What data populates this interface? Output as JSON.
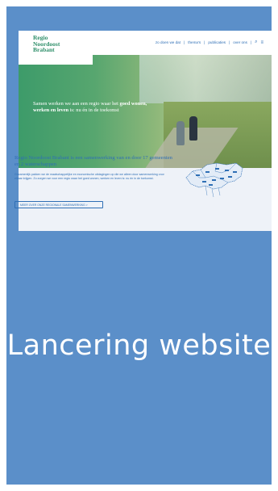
{
  "site": {
    "logo_lines": [
      "Regio",
      "Noordoost",
      "Brabant"
    ],
    "nav": [
      "zo doen we dat",
      "thema's",
      "publicaties",
      "over ons"
    ],
    "hero_text_pre": "Samen werken we aan een regio waar het ",
    "hero_text_bold": "goed wonen, werken en leven",
    "hero_text_post": " is: nu én in de toekomst",
    "intro_heading": "Regio Noordoost Brabant is een samenwerking van en door 17 gemeenten en 2 waterschappen",
    "intro_body": "Gezamenlijk pakken we de maatschappelijke en economische uitdagingen op die we alleen door samenwerking voor elkaar krijgen. Zo zorgen we voor een regio waar het goed wonen, werken en leven is: nu én in de toekomst.",
    "cta_label": "MEER OVER ONZE REGIONALE SAMENWERKING  >"
  },
  "caption": "Lancering website",
  "colors": {
    "card": "#5b8fc9",
    "brand_green": "#2f8f6a",
    "brand_blue": "#2f6fb5"
  }
}
